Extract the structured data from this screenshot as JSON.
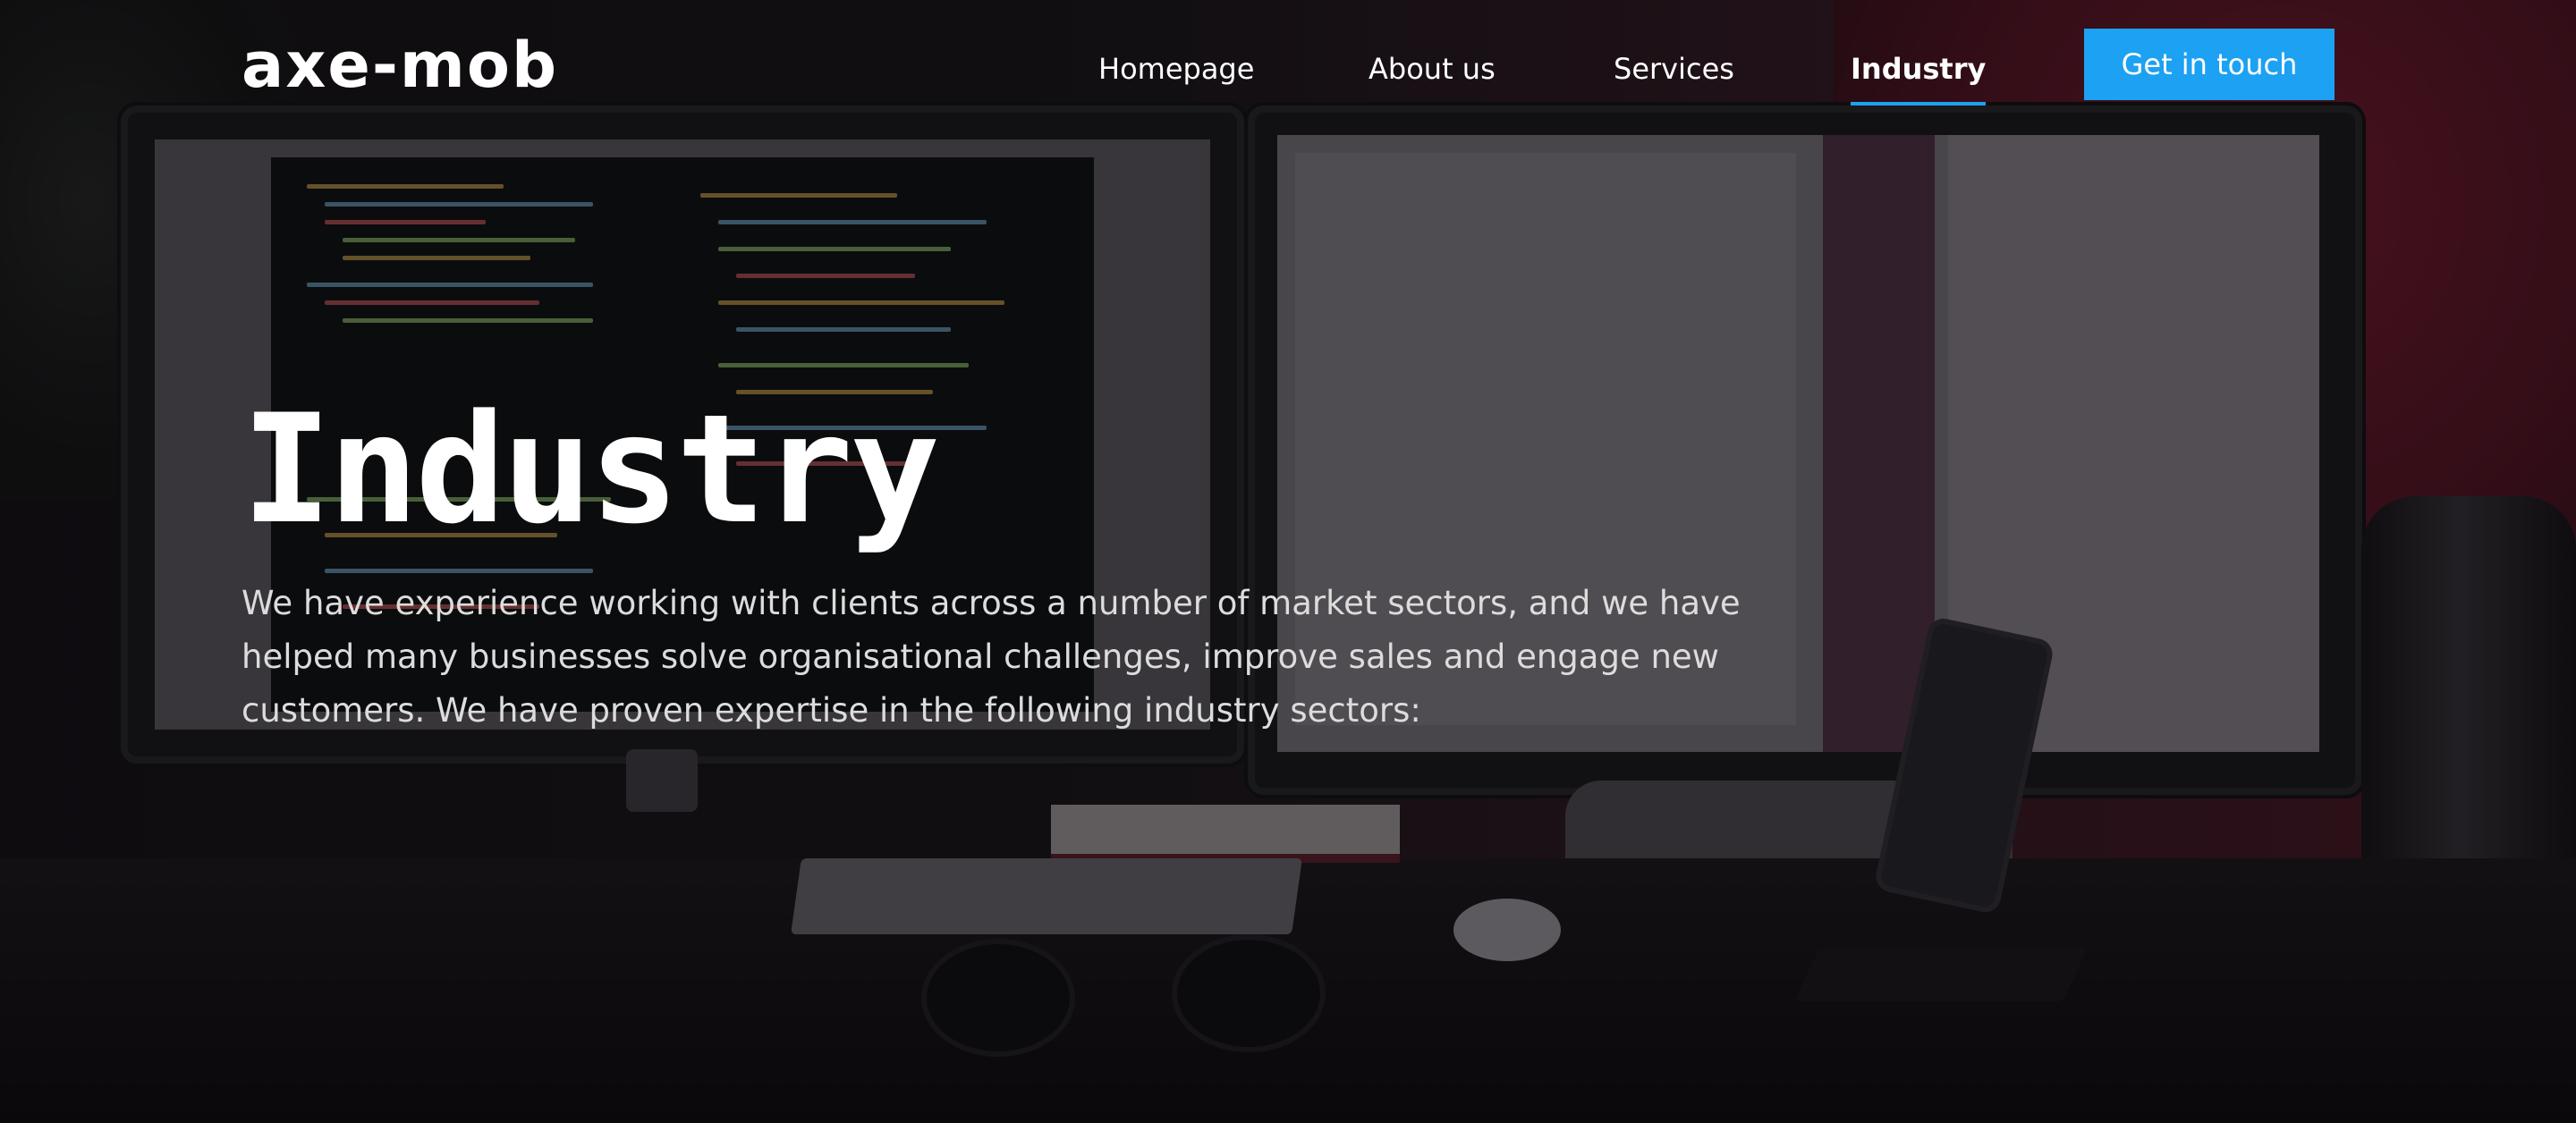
{
  "brand": {
    "logo_text": "axe-mob"
  },
  "nav": {
    "items": [
      {
        "label": "Homepage",
        "active": false
      },
      {
        "label": "About us",
        "active": false
      },
      {
        "label": "Services",
        "active": false
      },
      {
        "label": "Industry",
        "active": true
      }
    ],
    "cta_label": "Get in touch"
  },
  "hero": {
    "title": "Industry",
    "description": "We have experience working with clients across a number of market sectors, and we have helped many businesses solve organisational challenges, improve sales and engage new customers. We have proven expertise in the following industry sectors:",
    "background_image": "desk-with-monitors-photo"
  },
  "colors": {
    "accent": "#1da1f2",
    "text": "#ffffff",
    "body_text": "#dcdcdc",
    "overlay": "#0a080c"
  }
}
